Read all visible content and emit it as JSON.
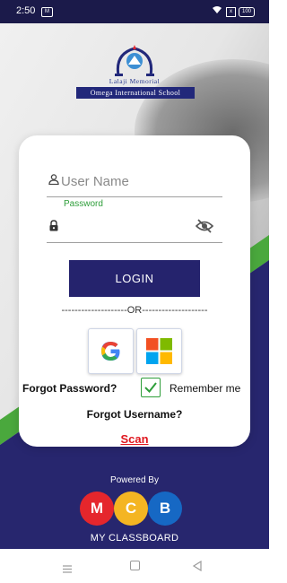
{
  "status_bar": {
    "time": "2:50",
    "notification_badge": "M",
    "sim_label": "x",
    "battery": "100",
    "icons": [
      "wifi-icon",
      "sim-icon",
      "battery-icon"
    ]
  },
  "logo": {
    "line1": "Lalaji Memorial",
    "line2": "Omega International School"
  },
  "login_form": {
    "username_placeholder": "User Name",
    "password_label": "Password",
    "password_value": "",
    "login_label": "LOGIN",
    "or_text": "--------------------OR--------------------",
    "forgot_password": "Forgot Password?",
    "remember_me": "Remember me",
    "remember_checked": true,
    "forgot_username": "Forgot Username?",
    "scan": "Scan"
  },
  "footer": {
    "powered_by": "Powered By",
    "letters": [
      "M",
      "C",
      "B"
    ],
    "brand": "MY CLASSBOARD"
  },
  "colors": {
    "navy": "#25236d",
    "green": "#2e9e3a",
    "red": "#e0171f",
    "mcb_red": "#e5262c",
    "mcb_yellow": "#f4b522",
    "mcb_blue": "#1668c4"
  }
}
